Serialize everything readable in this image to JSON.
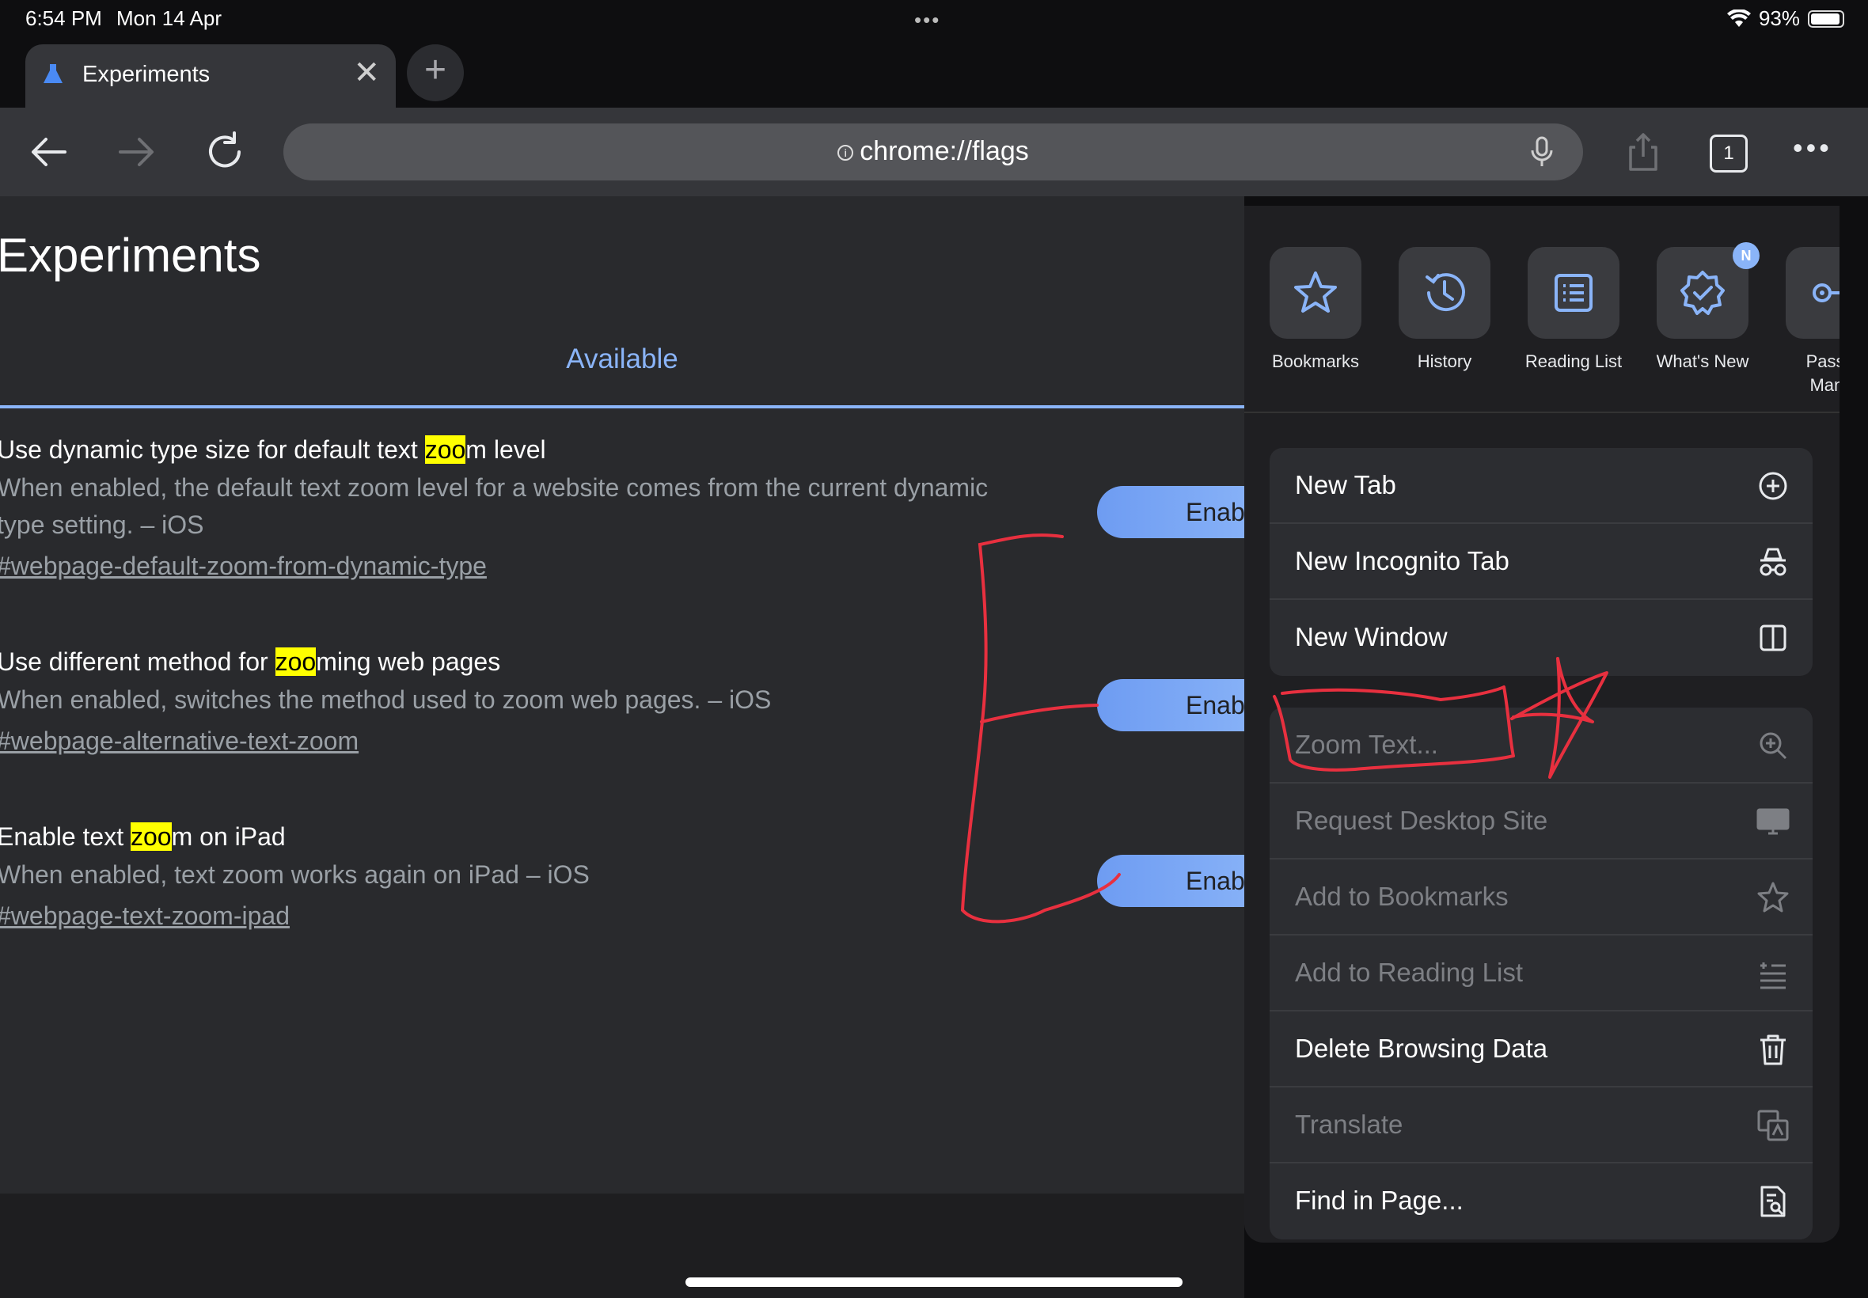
{
  "status_bar": {
    "time": "6:54 PM",
    "date": "Mon 14 Apr",
    "battery": "93%"
  },
  "tab": {
    "title": "Experiments"
  },
  "omnibox": {
    "url": "chrome://flags"
  },
  "toolbar": {
    "tab_count": "1"
  },
  "page": {
    "heading": "Experiments",
    "active_tab": "Available",
    "flags": [
      {
        "title_before": "Use dynamic type size for default text ",
        "title_highlight": "zoo",
        "title_after": "m level",
        "description": "When enabled, the default text zoom level for a website comes from the current dynamic type setting. – iOS",
        "link": "#webpage-default-zoom-from-dynamic-type",
        "button": "Enab"
      },
      {
        "title_before": "Use different method for ",
        "title_highlight": "zoo",
        "title_after": "ming web pages",
        "description": "When enabled, switches the method used to zoom web pages. – iOS",
        "link": "#webpage-alternative-text-zoom",
        "button": "Enab"
      },
      {
        "title_before": "Enable text ",
        "title_highlight": "zoo",
        "title_after": "m on iPad",
        "description": "When enabled, text zoom works again on iPad – iOS",
        "link": "#webpage-text-zoom-ipad",
        "button": "Enab"
      }
    ]
  },
  "menu": {
    "quick_actions": [
      {
        "label": "Bookmarks",
        "icon": "star-icon"
      },
      {
        "label": "History",
        "icon": "history-icon"
      },
      {
        "label": "Reading List",
        "icon": "reading-list-icon"
      },
      {
        "label": "What's New",
        "icon": "whats-new-icon",
        "badge": "N"
      },
      {
        "label": "Passw\nMana",
        "icon": "password-manager-icon"
      }
    ],
    "group1": [
      {
        "label": "New Tab",
        "icon": "plus-circle-icon"
      },
      {
        "label": "New Incognito Tab",
        "icon": "incognito-icon"
      },
      {
        "label": "New Window",
        "icon": "window-icon"
      }
    ],
    "group2": [
      {
        "label": "Zoom Text...",
        "icon": "zoom-in-icon",
        "enabled": false
      },
      {
        "label": "Request Desktop Site",
        "icon": "desktop-icon",
        "enabled": false
      },
      {
        "label": "Add to Bookmarks",
        "icon": "star-outline-icon",
        "enabled": false
      },
      {
        "label": "Add to Reading List",
        "icon": "add-reading-list-icon",
        "enabled": false
      },
      {
        "label": "Delete Browsing Data",
        "icon": "trash-icon",
        "enabled": true
      },
      {
        "label": "Translate",
        "icon": "translate-icon",
        "enabled": false
      },
      {
        "label": "Find in Page...",
        "icon": "find-in-page-icon",
        "enabled": true
      }
    ]
  },
  "colors": {
    "accent": "#8ab4f8",
    "highlight": "#ffff00",
    "annotation": "#e8303f"
  }
}
